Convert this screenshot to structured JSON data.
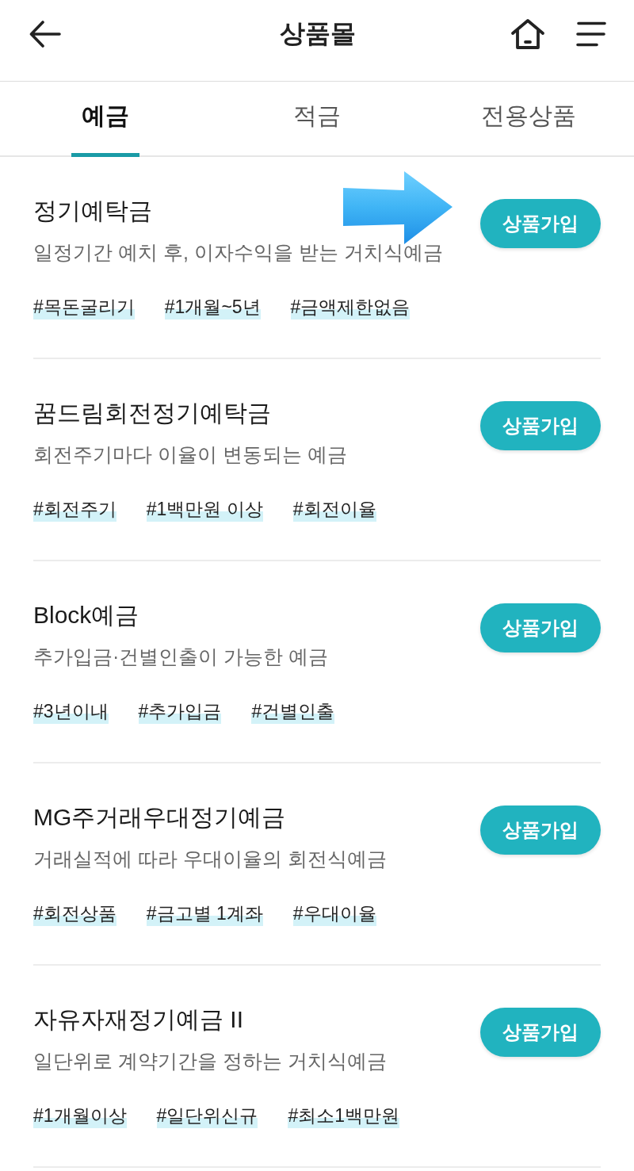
{
  "header": {
    "title": "상품몰"
  },
  "tabs": [
    {
      "label": "예금",
      "selected": true
    },
    {
      "label": "적금",
      "selected": false
    },
    {
      "label": "전용상품",
      "selected": false
    }
  ],
  "products": [
    {
      "name": "정기예탁금",
      "description": "일정기간 예치 후, 이자수익을 받는 거치식예금",
      "tags": [
        "#목돈굴리기",
        "#1개월~5년",
        "#금액제한없음"
      ],
      "button": "상품가입"
    },
    {
      "name": "꿈드림회전정기예탁금",
      "description": "회전주기마다 이율이 변동되는 예금",
      "tags": [
        "#회전주기",
        "#1백만원 이상",
        "#회전이율"
      ],
      "button": "상품가입"
    },
    {
      "name": "Block예금",
      "description": "추가입금·건별인출이 가능한 예금",
      "tags": [
        "#3년이내",
        "#추가입금",
        "#건별인출"
      ],
      "button": "상품가입"
    },
    {
      "name": "MG주거래우대정기예금",
      "description": "거래실적에 따라 우대이율의 회전식예금",
      "tags": [
        "#회전상품",
        "#금고별 1계좌",
        "#우대이율"
      ],
      "button": "상품가입"
    },
    {
      "name": "자유자재정기예금 II",
      "description": "일단위로 계약기간을 정하는 거치식예금",
      "tags": [
        "#1개월이상",
        "#일단위신규",
        "#최소1백만원"
      ],
      "button": "상품가입"
    }
  ]
}
